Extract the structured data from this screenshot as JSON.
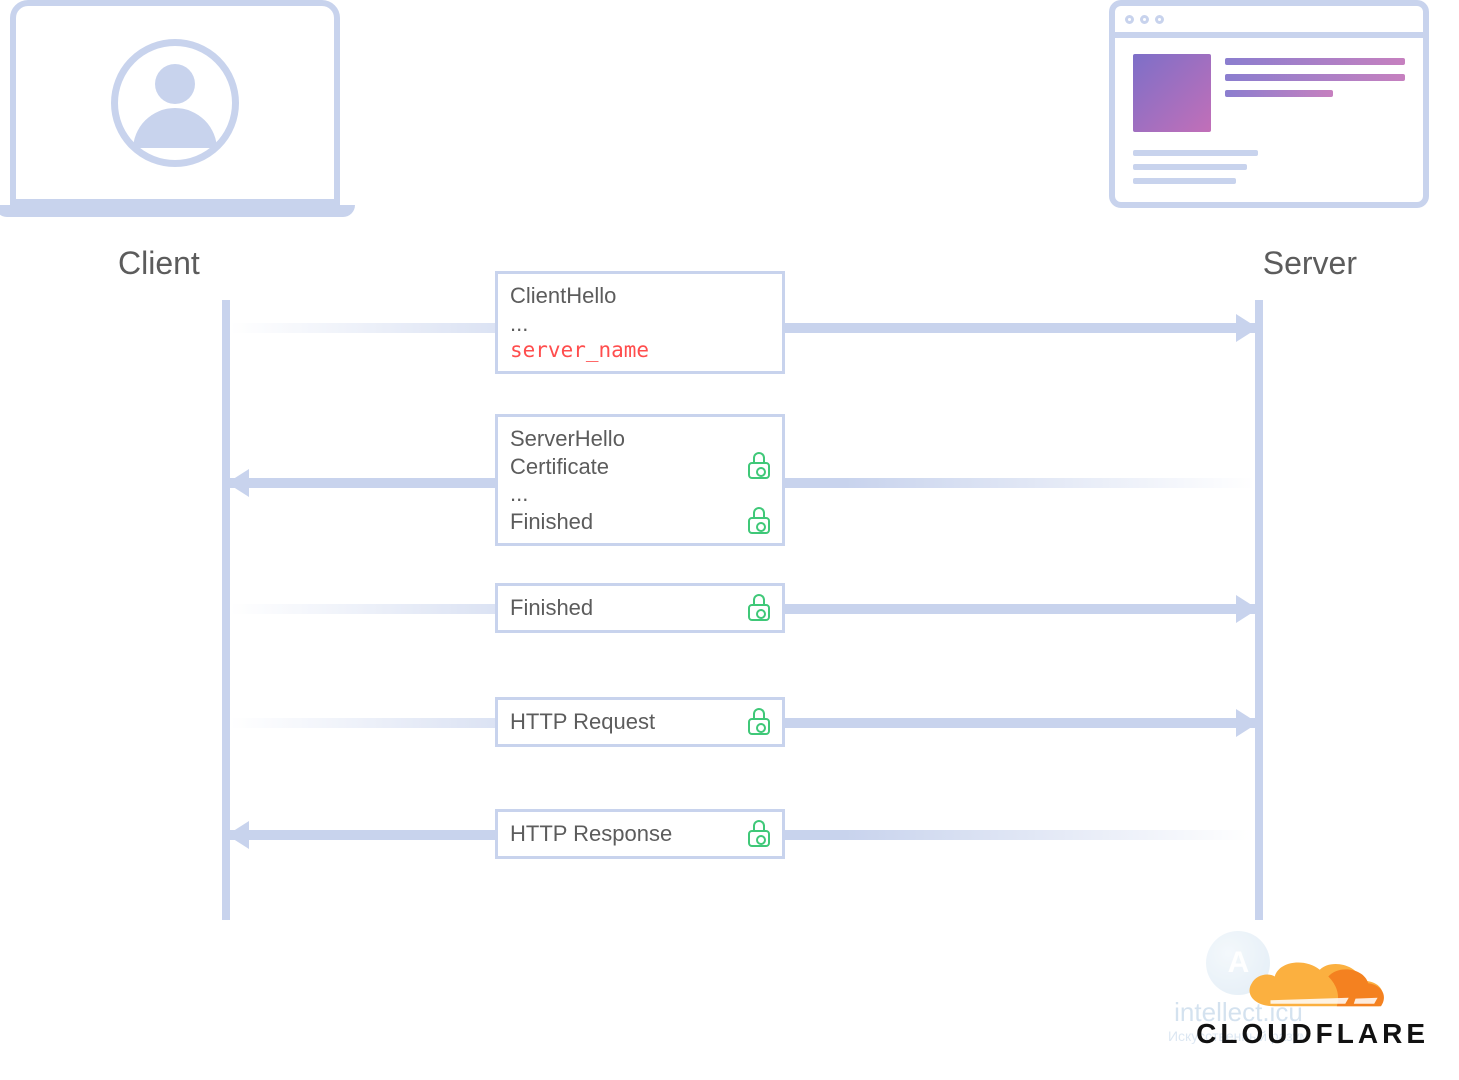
{
  "labels": {
    "client": "Client",
    "server": "Server"
  },
  "messages": {
    "m1": {
      "direction": "right",
      "lines": [
        {
          "text": "ClientHello",
          "lock": false,
          "highlight": false
        },
        {
          "text": "...",
          "lock": false,
          "highlight": false
        },
        {
          "text": "server_name",
          "lock": false,
          "highlight": true
        }
      ]
    },
    "m2": {
      "direction": "left",
      "lines": [
        {
          "text": "ServerHello",
          "lock": false,
          "highlight": false
        },
        {
          "text": "Certificate",
          "lock": true,
          "highlight": false
        },
        {
          "text": "...",
          "lock": false,
          "highlight": false
        },
        {
          "text": "Finished",
          "lock": true,
          "highlight": false
        }
      ]
    },
    "m3": {
      "direction": "right",
      "lines": [
        {
          "text": "Finished",
          "lock": true,
          "highlight": false
        }
      ]
    },
    "m4": {
      "direction": "right",
      "lines": [
        {
          "text": "HTTP Request",
          "lock": true,
          "highlight": false
        }
      ]
    },
    "m5": {
      "direction": "left",
      "lines": [
        {
          "text": "HTTP Response",
          "lock": true,
          "highlight": false
        }
      ]
    }
  },
  "branding": {
    "logo_text": "CLOUDFLARE"
  },
  "watermark": {
    "letter": "A",
    "title": "intellect.icu",
    "subtitle": "Искусственный разум"
  },
  "colors": {
    "line": "#c8d3ed",
    "highlight": "#ff4d4d",
    "lock": "#3fc878",
    "logo_orange": "#f48120",
    "logo_light": "#fbb040"
  }
}
